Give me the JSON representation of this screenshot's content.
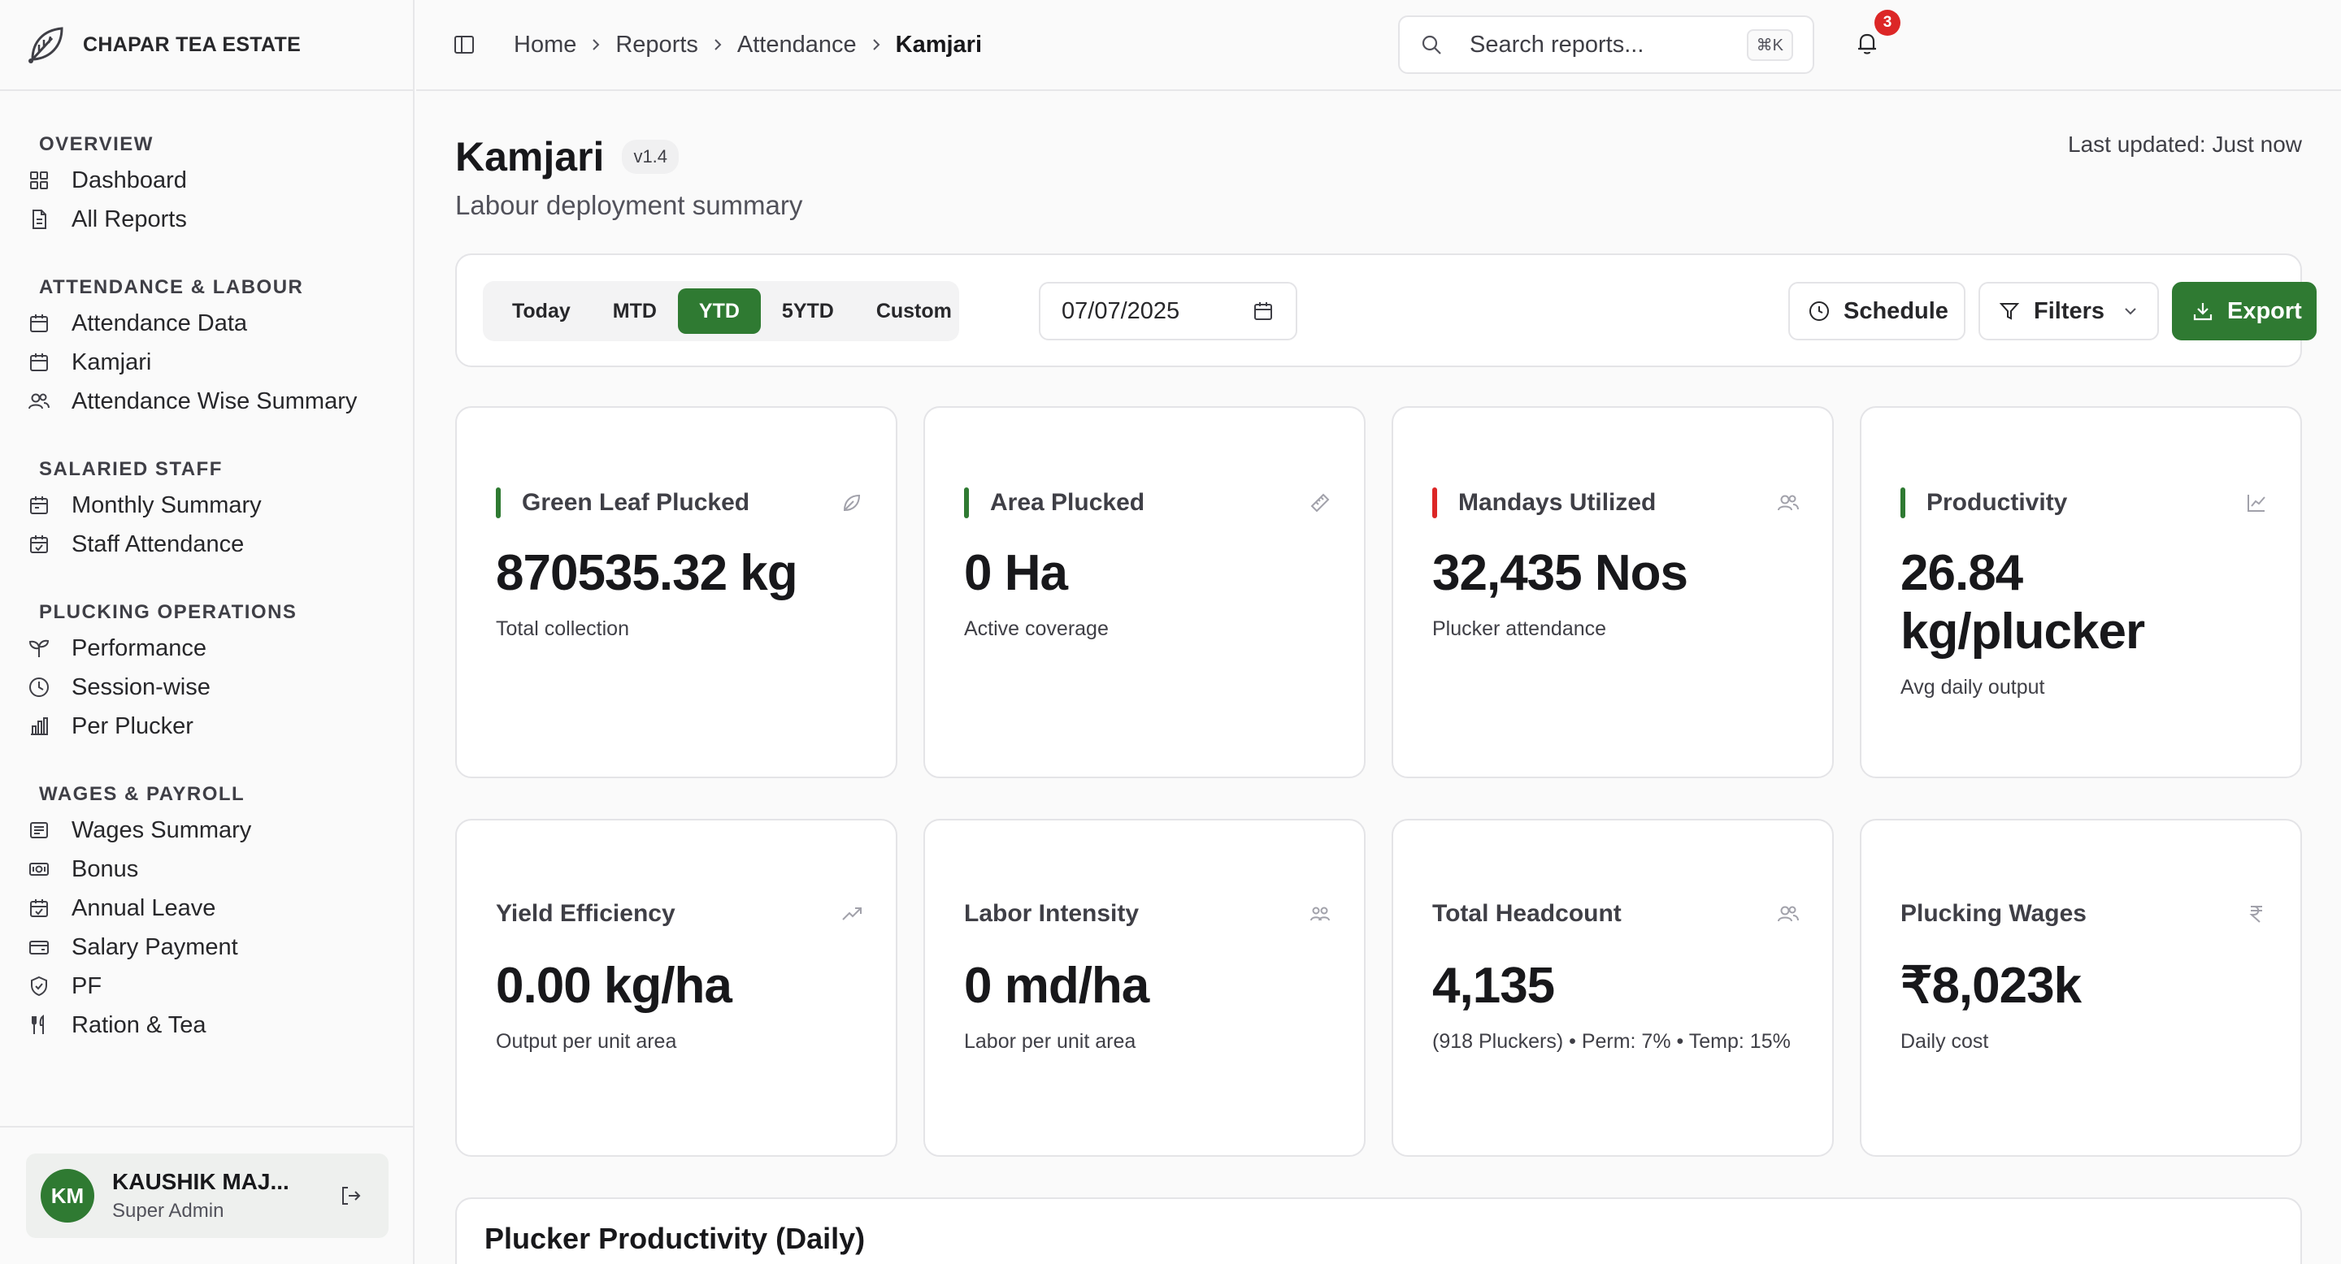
{
  "brand": {
    "name": "CHAPAR TEA ESTATE",
    "logo_icon": "tea-leaf-icon"
  },
  "sidebar": {
    "sections": [
      {
        "title": "OVERVIEW",
        "items": [
          {
            "label": "Dashboard",
            "icon": "grid-icon"
          },
          {
            "label": "All Reports",
            "icon": "file-icon"
          }
        ]
      },
      {
        "title": "ATTENDANCE & LABOUR",
        "items": [
          {
            "label": "Attendance Data",
            "icon": "calendar-icon"
          },
          {
            "label": "Kamjari",
            "icon": "calendar-icon"
          },
          {
            "label": "Attendance Wise Summary",
            "icon": "users-icon"
          }
        ]
      },
      {
        "title": "SALARIED STAFF",
        "items": [
          {
            "label": "Monthly Summary",
            "icon": "calendar-range-icon"
          },
          {
            "label": "Staff Attendance",
            "icon": "calendar-check-icon"
          }
        ]
      },
      {
        "title": "PLUCKING OPERATIONS",
        "items": [
          {
            "label": "Performance",
            "icon": "sprout-icon"
          },
          {
            "label": "Session-wise",
            "icon": "clock-icon"
          },
          {
            "label": "Per Plucker",
            "icon": "bar-chart-icon"
          }
        ]
      },
      {
        "title": "WAGES & PAYROLL",
        "items": [
          {
            "label": "Wages Summary",
            "icon": "receipt-icon"
          },
          {
            "label": "Bonus",
            "icon": "banknote-icon"
          },
          {
            "label": "Annual Leave",
            "icon": "calendar-check-icon"
          },
          {
            "label": "Salary Payment",
            "icon": "wallet-icon"
          },
          {
            "label": "PF",
            "icon": "shield-icon"
          },
          {
            "label": "Ration & Tea",
            "icon": "utensils-icon"
          }
        ]
      }
    ],
    "user": {
      "initials": "KM",
      "name": "KAUSHIK MAJ...",
      "role": "Super Admin"
    }
  },
  "topbar": {
    "breadcrumb": [
      "Home",
      "Reports",
      "Attendance",
      "Kamjari"
    ],
    "search_placeholder": "Search reports...",
    "shortcut": "⌘K",
    "notification_count": "3"
  },
  "page": {
    "title": "Kamjari",
    "version": "v1.4",
    "subtitle": "Labour deployment summary",
    "last_updated": "Last updated: Just now"
  },
  "toolbar": {
    "periods": [
      "Today",
      "MTD",
      "YTD",
      "5YTD",
      "Custom"
    ],
    "active_period": "YTD",
    "date": "07/07/2025",
    "schedule_label": "Schedule",
    "filters_label": "Filters",
    "export_label": "Export"
  },
  "kpis": [
    {
      "label": "Green Leaf Plucked",
      "value": "870535.32 kg",
      "note": "Total collection",
      "accent": "#2f7a32",
      "icon": "leaf-icon"
    },
    {
      "label": "Area Plucked",
      "value": "0 Ha",
      "note": "Active coverage",
      "accent": "#2f7a32",
      "icon": "ruler-icon"
    },
    {
      "label": "Mandays Utilized",
      "value": "32,435 Nos",
      "note": "Plucker attendance",
      "accent": "#dc2626",
      "icon": "users-icon"
    },
    {
      "label": "Productivity",
      "value": "26.84 kg/plucker",
      "note": "Avg daily output",
      "accent": "#2f7a32",
      "icon": "line-chart-icon"
    },
    {
      "label": "Yield Efficiency",
      "value": "0.00 kg/ha",
      "note": "Output per unit area",
      "icon": "trending-up-icon"
    },
    {
      "label": "Labor Intensity",
      "value": "0 md/ha",
      "note": "Labor per unit area",
      "icon": "users-round-icon"
    },
    {
      "label": "Total Headcount",
      "value": "4,135",
      "note": "(918 Pluckers) • Perm: 7% • Temp: 15%",
      "icon": "users-icon"
    },
    {
      "label": "Plucking Wages",
      "value": "₹8,023k",
      "note": "Daily cost",
      "icon": "rupee-icon"
    }
  ],
  "chart_section": {
    "title": "Plucker Productivity (Daily)"
  }
}
